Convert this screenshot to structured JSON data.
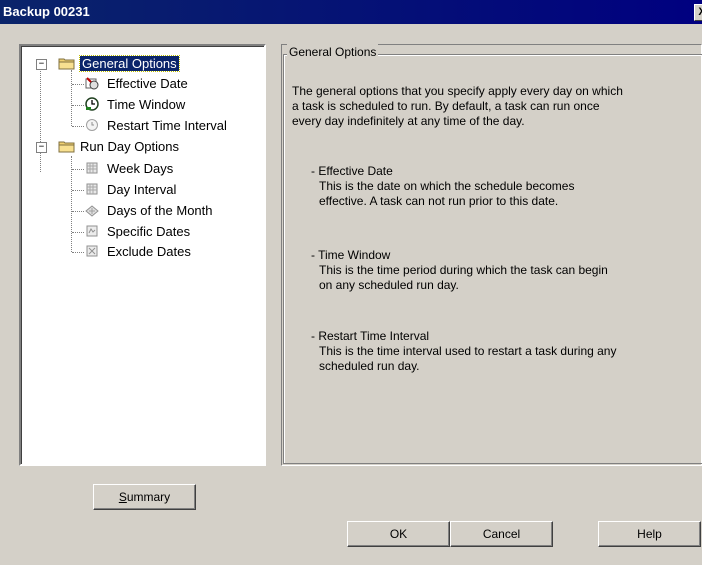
{
  "window": {
    "title": "Backup 00231",
    "close_glyph": "X"
  },
  "tree": {
    "groups": [
      {
        "label": "General Options",
        "expanded_glyph": "−",
        "items": [
          "Effective Date",
          "Time Window",
          "Restart Time Interval"
        ]
      },
      {
        "label": "Run Day Options",
        "expanded_glyph": "−",
        "items": [
          "Week Days",
          "Day Interval",
          "Days of the Month",
          "Specific Dates",
          "Exclude Dates"
        ]
      }
    ]
  },
  "panel": {
    "group_title": "General Options",
    "intro": [
      "The general options that you specify apply every day on which",
      "a task is scheduled to run. By default, a task can run once",
      "every day indefinitely at any time of the day."
    ],
    "sections": [
      {
        "heading": "- Effective Date",
        "body": [
          "This is the date on which the schedule becomes",
          "effective. A task can not run prior to this date."
        ]
      },
      {
        "heading": "- Time Window",
        "body": [
          "This is the time period during which the task can begin",
          "on any scheduled run day."
        ]
      },
      {
        "heading": "- Restart Time Interval",
        "body": [
          "This is the time interval used to restart a task during any",
          "scheduled run day."
        ]
      }
    ]
  },
  "buttons": {
    "summary_label_prefix": "S",
    "summary_label_rest": "ummary",
    "ok": "OK",
    "cancel": "Cancel",
    "help": "Help"
  },
  "colors": {
    "titlebar": "#0a246a",
    "dialog_bg": "#d4d0c8",
    "selection": "#0a246a"
  }
}
